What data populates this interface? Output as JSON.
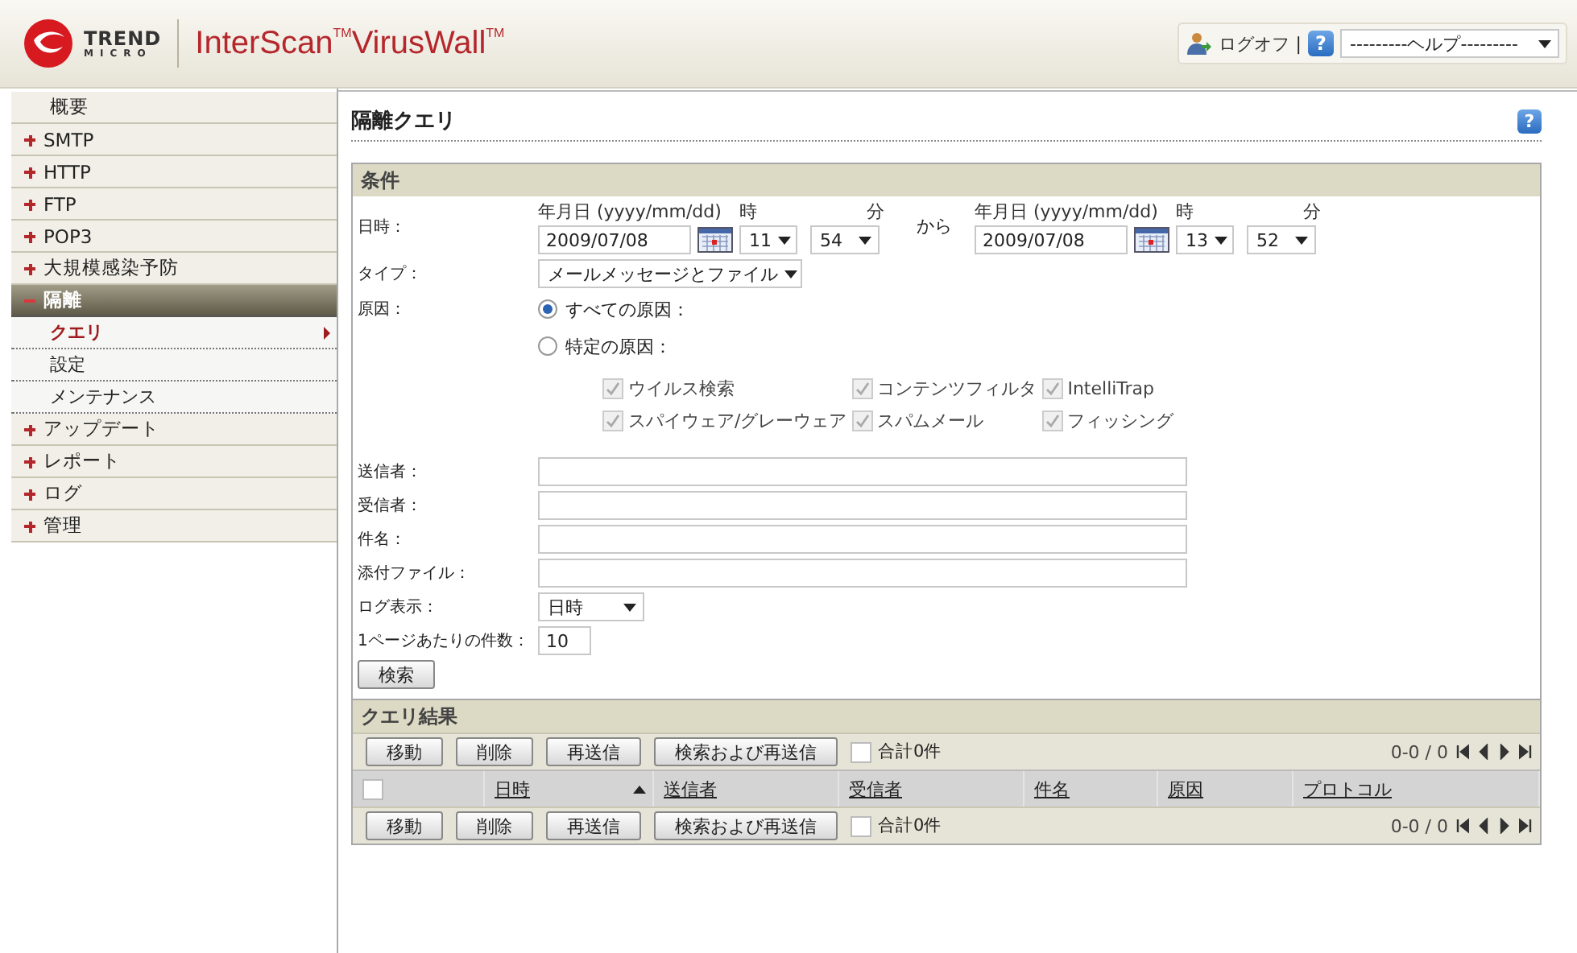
{
  "header": {
    "brand_top": "TREND",
    "brand_bottom": "MICRO",
    "product": "InterScan$^{TM}$VirusWall$^{TM}$",
    "logoff": "ログオフ",
    "separator": "|",
    "help_icon": "?",
    "help_select": "---------ヘルプ---------"
  },
  "sidebar": {
    "items": [
      {
        "kind": "link",
        "label": "概要"
      },
      {
        "kind": "group",
        "label": "SMTP",
        "expanded": false
      },
      {
        "kind": "group",
        "label": "HTTP",
        "expanded": false
      },
      {
        "kind": "group",
        "label": "FTP",
        "expanded": false
      },
      {
        "kind": "group",
        "label": "POP3",
        "expanded": false
      },
      {
        "kind": "group",
        "label": "大規模感染予防",
        "expanded": false
      },
      {
        "kind": "group",
        "label": "隔離",
        "expanded": true,
        "children": [
          {
            "label": "クエリ",
            "selected": true
          },
          {
            "label": "設定",
            "selected": false
          },
          {
            "label": "メンテナンス",
            "selected": false
          }
        ]
      },
      {
        "kind": "group",
        "label": "アップデート",
        "expanded": false
      },
      {
        "kind": "group",
        "label": "レポート",
        "expanded": false
      },
      {
        "kind": "group",
        "label": "ログ",
        "expanded": false
      },
      {
        "kind": "group",
        "label": "管理",
        "expanded": false
      }
    ]
  },
  "page": {
    "title": "隔離クエリ",
    "help_icon": "?"
  },
  "conditions": {
    "title": "条件",
    "datetime": {
      "label": "日時：",
      "separator": "から",
      "from": {
        "date_label": "年月日 (yyyy/mm/dd)",
        "hour_label": "時",
        "minute_label": "分",
        "date": "2009/07/08",
        "hour": "11",
        "minute": "54"
      },
      "to": {
        "date_label": "年月日 (yyyy/mm/dd)",
        "hour_label": "時",
        "minute_label": "分",
        "date": "2009/07/08",
        "hour": "13",
        "minute": "52"
      }
    },
    "type": {
      "label": "タイプ：",
      "value": "メールメッセージとファイル"
    },
    "reason": {
      "label": "原因：",
      "options": [
        {
          "label": "すべての原因：",
          "selected": true
        },
        {
          "label": "特定の原因：",
          "selected": false
        }
      ],
      "checks": [
        {
          "label": "ウイルス検索",
          "checked": true,
          "disabled": true
        },
        {
          "label": "コンテンツフィルタ",
          "checked": true,
          "disabled": true
        },
        {
          "label": "IntelliTrap",
          "checked": true,
          "disabled": true
        },
        {
          "label": "スパイウェア/グレーウェア",
          "checked": true,
          "disabled": true
        },
        {
          "label": "スパムメール",
          "checked": true,
          "disabled": true
        },
        {
          "label": "フィッシング",
          "checked": true,
          "disabled": true
        }
      ]
    },
    "text_fields": [
      {
        "label": "送信者："
      },
      {
        "label": "受信者："
      },
      {
        "label": "件名："
      },
      {
        "label": "添付ファイル："
      }
    ],
    "log_display": {
      "label": "ログ表示：",
      "value": "日時"
    },
    "per_page": {
      "label": "1ページあたりの件数：",
      "value": "10"
    },
    "search_button": "検索"
  },
  "results": {
    "title": "クエリ結果",
    "toolbars": [
      {
        "buttons": [
          "移動",
          "削除",
          "再送信",
          "検索および再送信"
        ],
        "checked": false,
        "total": "合計0件",
        "paging": "0-0 / 0"
      },
      {
        "buttons": [
          "移動",
          "削除",
          "再送信",
          "検索および再送信"
        ],
        "checked": false,
        "total": "合計0件",
        "paging": "0-0 / 0"
      }
    ],
    "select_all": false,
    "columns": [
      {
        "label": "日時",
        "sorted": true
      },
      {
        "label": "送信者",
        "sorted": false
      },
      {
        "label": "受信者",
        "sorted": false
      },
      {
        "label": "件名",
        "sorted": false
      },
      {
        "label": "原因",
        "sorted": false
      },
      {
        "label": "プロトコル",
        "sorted": false
      }
    ]
  }
}
